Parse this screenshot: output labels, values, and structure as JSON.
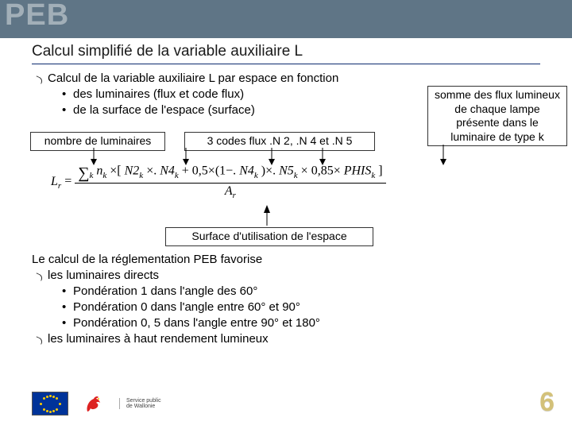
{
  "header": {
    "logo": "PEB"
  },
  "title": "Calcul simplifié de la variable auxiliaire L",
  "bullets": {
    "b1": "Calcul de la variable auxiliaire L par espace en fonction",
    "b1a": "des luminaires (flux et code flux)",
    "b1b": "de la surface de l'espace (surface)"
  },
  "boxes": {
    "left": "nombre de luminaires",
    "mid": "3 codes flux .N 2, .N 4 et .N 5",
    "right": "somme des flux lumineux de chaque lampe présente dans le luminaire de type k",
    "surface": "Surface d'utilisation de l'espace"
  },
  "formula": {
    "lhs": "L",
    "lhs_sub": "r",
    "eq": "=",
    "sum": "∑",
    "sum_sub": "k",
    "n": "n",
    "n_sub": "k",
    "open": "×[",
    "t1a": "N2",
    "t1b": "k",
    "mul": "×.",
    "t2a": "N4",
    "t2b": "k",
    "plus": "+ 0,5×(1−.",
    "close1": ")×.",
    "t3a": "N5",
    "t3b": "k",
    "tail": "× 0,85×",
    "phis": "PHIS",
    "phis_sub": "k",
    "close2": "]",
    "over": "A",
    "over_sub": "r"
  },
  "section2": {
    "lead": "Le calcul de la réglementation PEB favorise",
    "a": "les luminaires directs",
    "a1": "Pondération 1 dans l'angle des 60°",
    "a2": "Pondération 0 dans l'angle entre 60° et 90°",
    "a3": "Pondération 0, 5 dans l'angle entre 90° et 180°",
    "b": "les luminaires à haut rendement lumineux"
  },
  "footer": {
    "spw1": "Service public",
    "spw2": "de Wallonie"
  },
  "page": "6"
}
